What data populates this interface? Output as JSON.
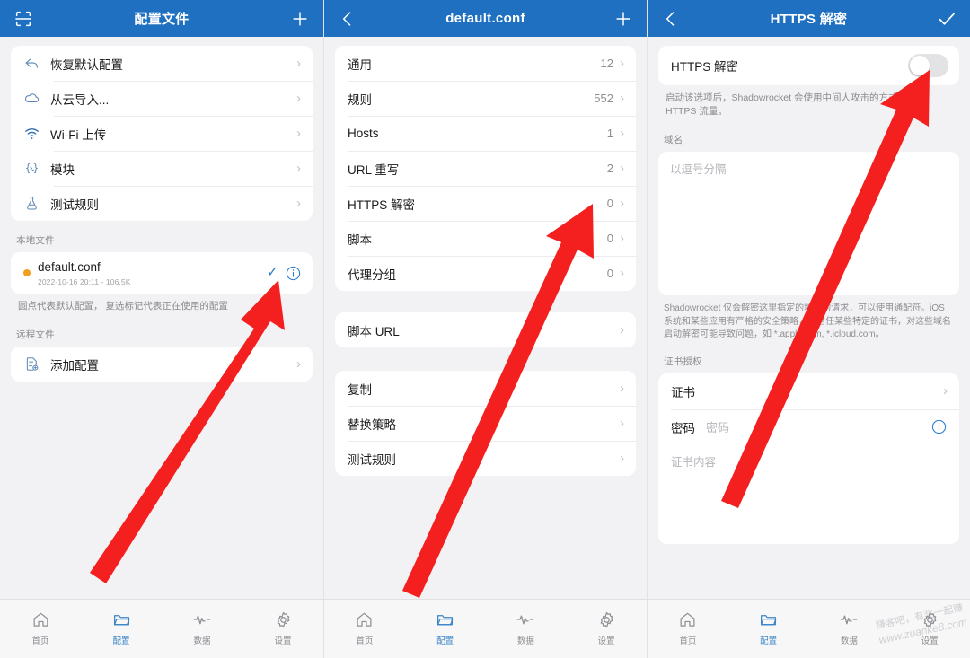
{
  "panel1": {
    "nav": {
      "scan_icon": "scan-icon",
      "title": "配置文件",
      "add_icon": "plus-icon"
    },
    "actions": [
      {
        "icon": "restore-arrow-icon",
        "label": "恢复默认配置"
      },
      {
        "icon": "cloud-icon",
        "label": "从云导入..."
      },
      {
        "icon": "wifi-icon",
        "label": "Wi-Fi 上传"
      },
      {
        "icon": "code-braces-icon",
        "label": "模块"
      },
      {
        "icon": "flask-icon",
        "label": "测试规则"
      }
    ],
    "local_title": "本地文件",
    "file": {
      "name": "default.conf",
      "meta": "2022-10-16 20:11 - 106.5K",
      "check_icon": "checkmark-icon",
      "info_icon": "info-circle-icon"
    },
    "hint": "圆点代表默认配置， 复选标记代表正在使用的配置",
    "remote_title": "远程文件",
    "remote_item": {
      "icon": "document-add-icon",
      "label": "添加配置"
    }
  },
  "panel2": {
    "nav": {
      "back_icon": "chevron-left-icon",
      "title": "default.conf",
      "add_icon": "plus-icon"
    },
    "sections": [
      {
        "label": "通用",
        "value": "12"
      },
      {
        "label": "规则",
        "value": "552"
      },
      {
        "label": "Hosts",
        "value": "1"
      },
      {
        "label": "URL 重写",
        "value": "2"
      },
      {
        "label": "HTTPS 解密",
        "value": "0"
      },
      {
        "label": "脚本",
        "value": "0"
      },
      {
        "label": "代理分组",
        "value": "0"
      }
    ],
    "script_url": {
      "label": "脚本 URL"
    },
    "tools": [
      {
        "label": "复制"
      },
      {
        "label": "替换策略"
      },
      {
        "label": "测试规则"
      }
    ]
  },
  "panel3": {
    "nav": {
      "back_icon": "chevron-left-icon",
      "title": "HTTPS 解密",
      "confirm_icon": "checkmark-icon"
    },
    "toggle": {
      "label": "HTTPS 解密",
      "state": "off"
    },
    "toggle_note": "启动该选项后，Shadowrocket 会使用中间人攻击的方式去解密 HTTPS 流量。",
    "domain_title": "域名",
    "domain_placeholder": "以逗号分隔",
    "domain_note": "Shadowrocket 仅会解密这里指定的域名的请求，可以使用通配符。iOS 系统和某些应用有严格的安全策略，仅信任某些特定的证书，对这些域名启动解密可能导致问题，如 *.apple.com, *.icloud.com。",
    "cert_title": "证书授权",
    "cert_row": {
      "label": "证书"
    },
    "password_row": {
      "label": "密码",
      "placeholder": "密码",
      "info_icon": "info-circle-icon"
    },
    "cert_body_placeholder": "证书内容"
  },
  "tabbar": {
    "items": [
      {
        "icon": "home-icon",
        "label": "首页",
        "active": false
      },
      {
        "icon": "folder-icon",
        "label": "配置",
        "active": true
      },
      {
        "icon": "pulse-icon",
        "label": "数据",
        "active": false
      },
      {
        "icon": "gear-icon",
        "label": "设置",
        "active": false
      }
    ]
  },
  "watermark": {
    "line1": "赚客吧，有奖一起赚",
    "line2": "www.zuanke8.com"
  },
  "colors": {
    "nav_blue": "#1f70c1",
    "accent": "#3b84c6",
    "arrow_red": "#f42020",
    "dot_orange": "#f0a01e"
  }
}
